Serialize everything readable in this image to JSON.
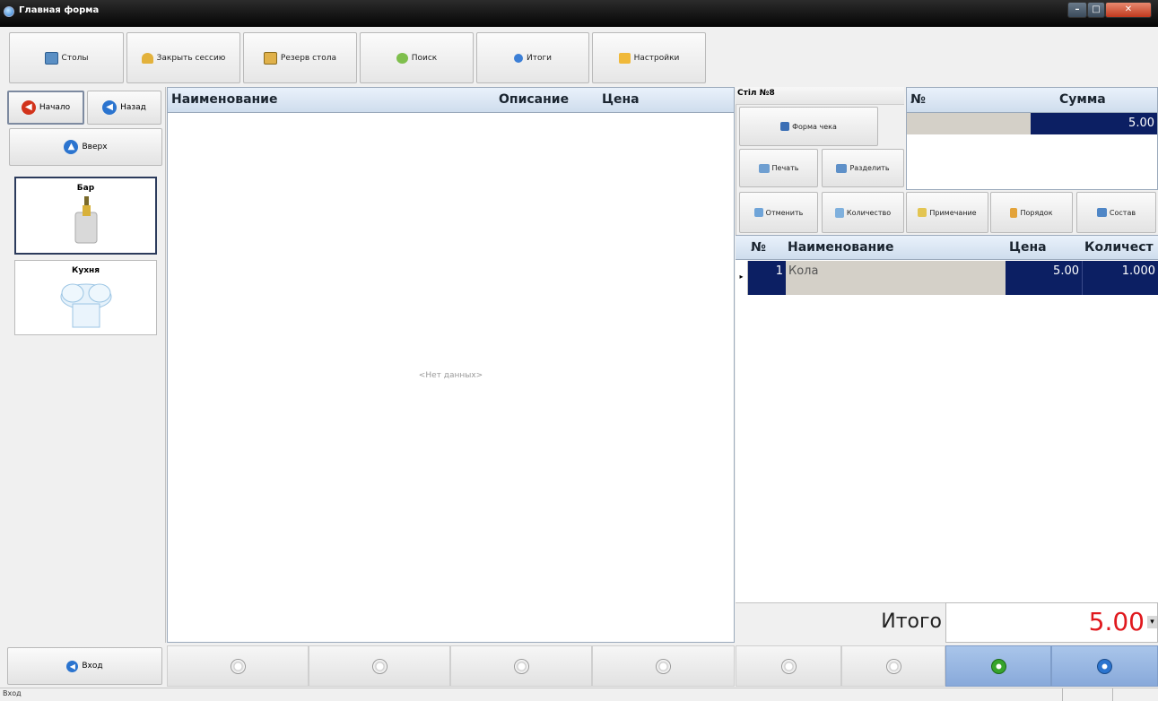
{
  "window": {
    "title": "Главная форма"
  },
  "toolbar": {
    "tables": "Столы",
    "close_session": "Закрыть сессию",
    "reserve_table": "Резерв стола",
    "search": "Поиск",
    "totals": "Итоги",
    "settings": "Настройки"
  },
  "nav": {
    "start": "Начало",
    "back": "Назад",
    "up": "Вверх"
  },
  "categories": [
    {
      "label": "Бар"
    },
    {
      "label": "Кухня"
    }
  ],
  "products": {
    "columns": [
      "Наименование",
      "Описание",
      "Цена"
    ],
    "empty_text": "<Нет данных>"
  },
  "table_panel": {
    "table_label": "Стіл №8",
    "receipt_form": "Форма чека",
    "print": "Печать",
    "split": "Разделить",
    "sum_columns": [
      "№",
      "Сумма"
    ],
    "sum_value": "5.00"
  },
  "actions": {
    "cancel": "Отменить",
    "quantity": "Количество",
    "note": "Примечание",
    "order": "Порядок",
    "composition": "Состав"
  },
  "order": {
    "columns": [
      "№",
      "Наименование",
      "Цена",
      "Количест"
    ],
    "rows": [
      {
        "num": "1",
        "name": "Кола",
        "price": "5.00",
        "qty": "1.000"
      }
    ]
  },
  "total": {
    "label": "Итого",
    "value": "5.00"
  },
  "bottom": {
    "enter": "Вход"
  },
  "status": {
    "text": "Вход"
  },
  "colors": {
    "selection": "#0c1f63",
    "total_red": "#e0191e",
    "header_grad": "#cfdded"
  }
}
